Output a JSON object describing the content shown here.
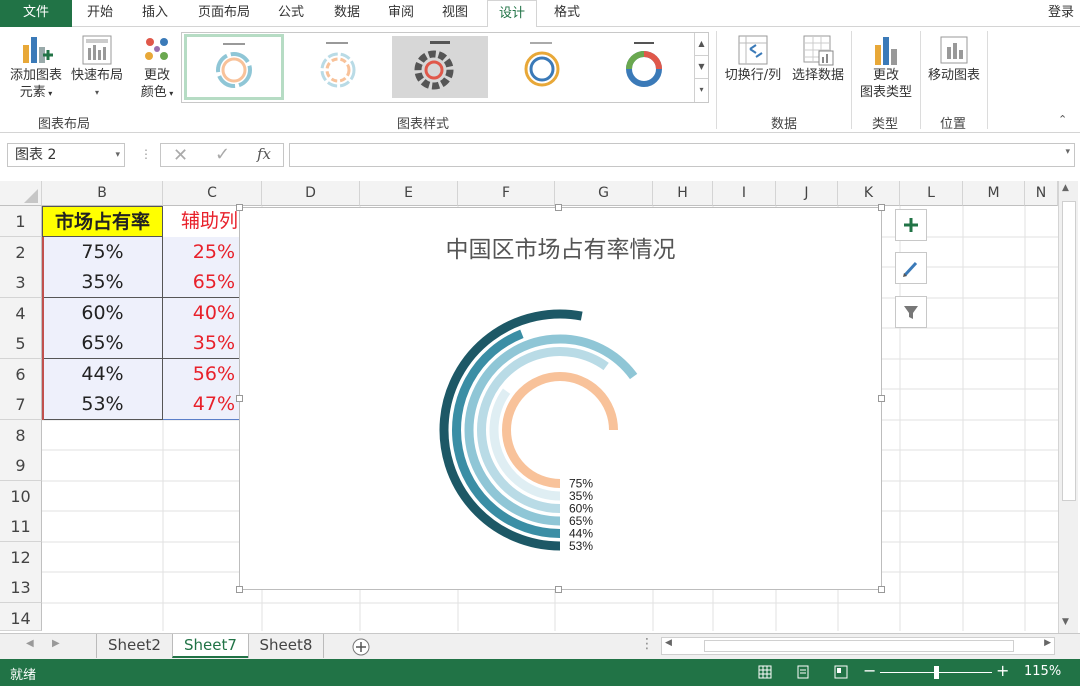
{
  "tabs": {
    "file": "文件",
    "items": [
      "开始",
      "插入",
      "页面布局",
      "公式",
      "数据",
      "审阅",
      "视图",
      "设计",
      "格式"
    ],
    "active_index": 7,
    "login": "登录"
  },
  "ribbon": {
    "add_element": "添加图表",
    "add_element2": "元素",
    "quick_layout": "快速布局",
    "change_color": "更改",
    "change_color2": "颜色",
    "group_layout": "图表布局",
    "group_styles": "图表样式",
    "switch_row_col": "切换行/列",
    "select_data": "选择数据",
    "group_data": "数据",
    "change_type": "更改",
    "change_type2": "图表类型",
    "group_type": "类型",
    "move_chart": "移动图表",
    "group_location": "位置"
  },
  "formula_bar": {
    "name_box": "图表 2",
    "fx": "fx",
    "value": ""
  },
  "columns": [
    "B",
    "C",
    "D",
    "E",
    "F",
    "G",
    "H",
    "I",
    "J",
    "K",
    "L",
    "M",
    "N"
  ],
  "rows": [
    "1",
    "2",
    "3",
    "4",
    "5",
    "6",
    "7",
    "8",
    "9",
    "10",
    "11",
    "12",
    "13",
    "14"
  ],
  "table": {
    "header_b": "市场占有率",
    "header_c": "辅助列",
    "b": [
      "75%",
      "35%",
      "60%",
      "65%",
      "44%",
      "53%"
    ],
    "c": [
      "25%",
      "65%",
      "40%",
      "35%",
      "56%",
      "47%"
    ]
  },
  "chart_data": {
    "type": "radial-bar",
    "title": "中国区市场占有率情况",
    "categories": [
      "75%",
      "35%",
      "60%",
      "65%",
      "44%",
      "53%"
    ],
    "series": [
      {
        "values": [
          0.75,
          0.35,
          0.6,
          0.65,
          0.44,
          0.53
        ]
      }
    ],
    "colors": [
      "#f8c29a",
      "#dfeef3",
      "#b9dbe6",
      "#8fc6d6",
      "#3b8ea5",
      "#1d5866"
    ]
  },
  "sheets": {
    "items": [
      "Sheet2",
      "Sheet7",
      "Sheet8"
    ],
    "active_index": 1
  },
  "status": {
    "ready": "就绪",
    "zoom": "115%"
  },
  "colors": {
    "excel_green": "#217346",
    "header_fill": "#ffff00",
    "red_text": "#e8202a",
    "table_fill": "#eef0fb"
  }
}
